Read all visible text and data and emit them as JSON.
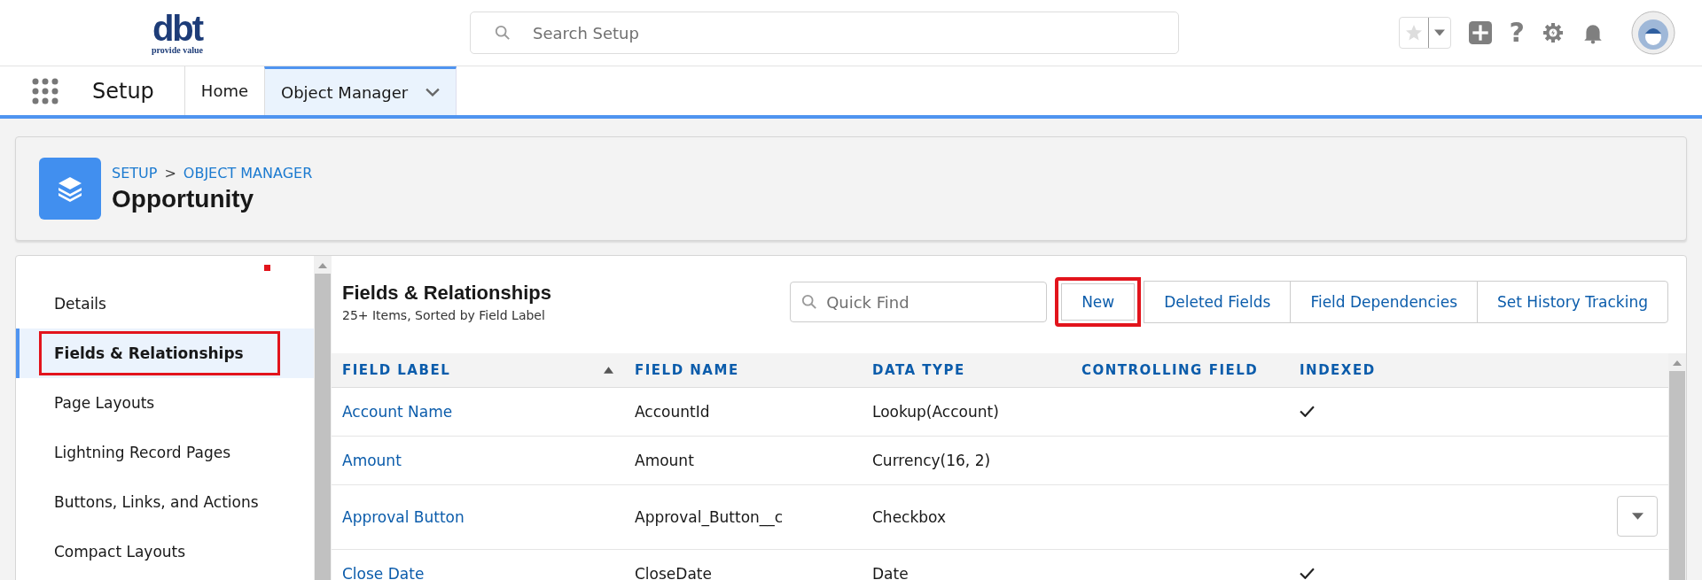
{
  "header": {
    "logo_text": "dbt",
    "logo_tagline": "provide value",
    "search": {
      "placeholder": "Search Setup"
    },
    "help_glyph": "?"
  },
  "nav": {
    "app_name": "Setup",
    "tabs": [
      {
        "label": "Home",
        "selected": false,
        "has_menu": false
      },
      {
        "label": "Object Manager",
        "selected": true,
        "has_menu": true
      }
    ]
  },
  "object_header": {
    "breadcrumb": [
      "SETUP",
      "OBJECT MANAGER"
    ],
    "separator": ">",
    "title": "Opportunity"
  },
  "sidebar": {
    "items": [
      {
        "label": "Details",
        "selected": false,
        "highlighted": false
      },
      {
        "label": "Fields & Relationships",
        "selected": true,
        "highlighted": true
      },
      {
        "label": "Page Layouts",
        "selected": false,
        "highlighted": false
      },
      {
        "label": "Lightning Record Pages",
        "selected": false,
        "highlighted": false
      },
      {
        "label": "Buttons, Links, and Actions",
        "selected": false,
        "highlighted": false
      },
      {
        "label": "Compact Layouts",
        "selected": false,
        "highlighted": false
      }
    ]
  },
  "panel": {
    "title": "Fields & Relationships",
    "subtitle": "25+ Items, Sorted by Field Label",
    "quick_find": {
      "placeholder": "Quick Find"
    },
    "buttons": [
      {
        "label": "New",
        "highlighted": true
      },
      {
        "label": "Deleted Fields",
        "highlighted": false
      },
      {
        "label": "Field Dependencies",
        "highlighted": false
      },
      {
        "label": "Set History Tracking",
        "highlighted": false
      }
    ]
  },
  "table": {
    "columns": [
      {
        "label": "FIELD LABEL",
        "sorted": true
      },
      {
        "label": "FIELD NAME",
        "sorted": false
      },
      {
        "label": "DATA TYPE",
        "sorted": false
      },
      {
        "label": "CONTROLLING FIELD",
        "sorted": false
      },
      {
        "label": "INDEXED",
        "sorted": false
      }
    ],
    "rows": [
      {
        "field_label": "Account Name",
        "field_name": "AccountId",
        "data_type": "Lookup(Account)",
        "indexed": true,
        "row_menu": false
      },
      {
        "field_label": "Amount",
        "field_name": "Amount",
        "data_type": "Currency(16, 2)",
        "indexed": false,
        "row_menu": false
      },
      {
        "field_label": "Approval Button",
        "field_name": "Approval_Button__c",
        "data_type": "Checkbox",
        "indexed": false,
        "row_menu": true
      },
      {
        "field_label": "Close Date",
        "field_name": "CloseDate",
        "data_type": "Date",
        "indexed": true,
        "row_menu": false
      }
    ]
  }
}
